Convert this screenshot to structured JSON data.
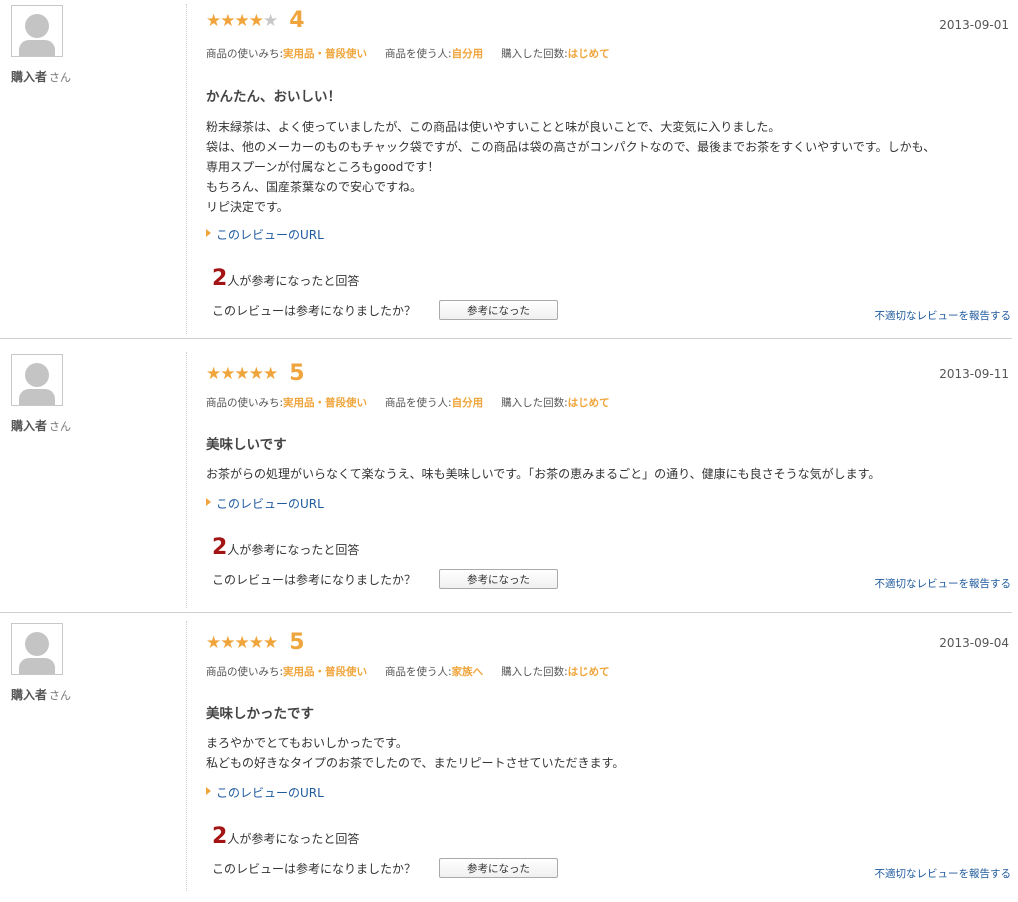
{
  "reviews": [
    {
      "reviewer_name": "購入者",
      "reviewer_suffix": "さん",
      "stars_on": "★★★★",
      "stars_off": "★",
      "rating": "4",
      "date": "2013-09-01",
      "meta": {
        "usage_label": "商品の使いみち:",
        "usage_value": "実用品・普段使い",
        "user_label": "商品を使う人:",
        "user_value": "自分用",
        "count_label": "購入した回数:",
        "count_value": "はじめて"
      },
      "title": "かんたん、おいしい！",
      "body": "粉末緑茶は、よく使っていましたが、この商品は使いやすいことと味が良いことで、大変気に入りました。\n袋は、他のメーカーのものもチャック袋ですが、この商品は袋の高さがコンパクトなので、最後までお茶をすくいやすいです。しかも、\n専用スプーンが付属なところもgoodです！\nもちろん、国産茶葉なので安心ですね。\nリピ決定です。",
      "url_link": "このレビューのURL",
      "helpful_num": "2",
      "helpful_text": "人が参考になったと回答",
      "question": "このレビューは参考になりましたか？",
      "helpful_button": "参考になった",
      "report_link": "不適切なレビューを報告する"
    },
    {
      "reviewer_name": "購入者",
      "reviewer_suffix": "さん",
      "stars_on": "★★★★★",
      "stars_off": "",
      "rating": "5",
      "date": "2013-09-11",
      "meta": {
        "usage_label": "商品の使いみち:",
        "usage_value": "実用品・普段使い",
        "user_label": "商品を使う人:",
        "user_value": "自分用",
        "count_label": "購入した回数:",
        "count_value": "はじめて"
      },
      "title": "美味しいです",
      "body": "お茶がらの処理がいらなくて楽なうえ、味も美味しいです。「お茶の恵みまるごと」の通り、健康にも良さそうな気がします。",
      "url_link": "このレビューのURL",
      "helpful_num": "2",
      "helpful_text": "人が参考になったと回答",
      "question": "このレビューは参考になりましたか？",
      "helpful_button": "参考になった",
      "report_link": "不適切なレビューを報告する"
    },
    {
      "reviewer_name": "購入者",
      "reviewer_suffix": "さん",
      "stars_on": "★★★★★",
      "stars_off": "",
      "rating": "5",
      "date": "2013-09-04",
      "meta": {
        "usage_label": "商品の使いみち:",
        "usage_value": "実用品・普段使い",
        "user_label": "商品を使う人:",
        "user_value": "家族へ",
        "count_label": "購入した回数:",
        "count_value": "はじめて"
      },
      "title": "美味しかったです",
      "body": "まろやかでとてもおいしかったです。\n私どもの好きなタイプのお茶でしたので、またリピートさせていただきます。",
      "url_link": "このレビューのURL",
      "helpful_num": "2",
      "helpful_text": "人が参考になったと回答",
      "question": "このレビューは参考になりましたか？",
      "helpful_button": "参考になった",
      "report_link": "不適切なレビューを報告する"
    }
  ]
}
